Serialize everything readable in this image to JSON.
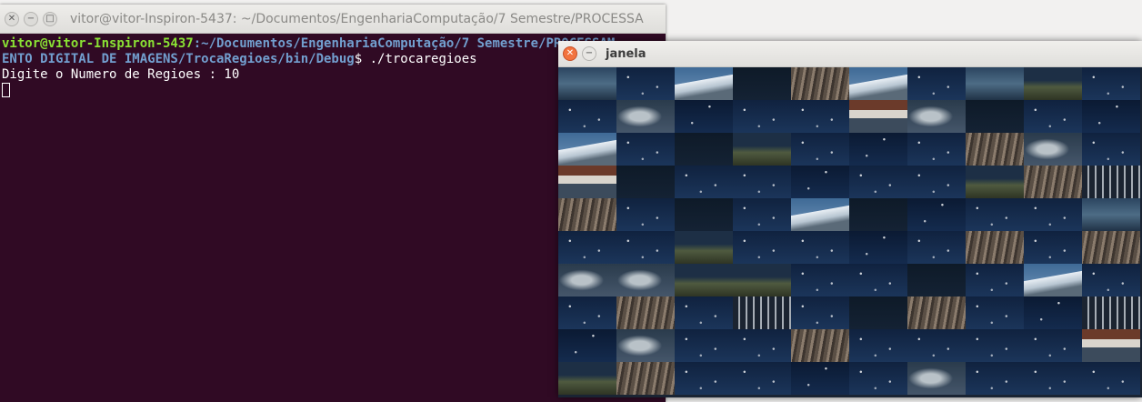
{
  "terminal": {
    "title": "vitor@vitor-Inspiron-5437: ~/Documentos/EngenhariaComputação/7 Semestre/PROCESSA",
    "prompt_user": "vitor@vitor-Inspiron-5437",
    "prompt_path_line1": "~/Documentos/EngenhariaComputação/7 Semestre/PROCESSAM",
    "prompt_path_line2": "ENTO DIGITAL DE IMAGENS/TrocaRegioes/bin/Debug",
    "prompt_symbol": "$ ",
    "command": "./trocaregioes",
    "output_line": "Digite o Numero de Regioes : 10"
  },
  "janela": {
    "title": "janela",
    "grid": {
      "rows": 10,
      "cols": 10
    }
  },
  "tiles": [
    "t-water",
    "t-star",
    "t-mtn",
    "t-dark",
    "t-dock",
    "t-mtn",
    "t-star",
    "t-water",
    "t-land",
    "t-star",
    "t-star",
    "t-cloud",
    "t-star2",
    "t-star",
    "t-star",
    "t-house",
    "t-cloud",
    "t-dark",
    "t-star",
    "t-star2",
    "t-mtn",
    "t-star",
    "t-dark",
    "t-land",
    "t-star",
    "t-star2",
    "t-star",
    "t-dock",
    "t-cloud",
    "t-star",
    "t-house",
    "t-dark",
    "t-star",
    "t-star",
    "t-star2",
    "t-star",
    "t-star",
    "t-land",
    "t-dock",
    "t-rail",
    "t-dock",
    "t-star",
    "t-dark",
    "t-star",
    "t-mtn",
    "t-dark",
    "t-star2",
    "t-star",
    "t-star",
    "t-water",
    "t-star",
    "t-star",
    "t-land",
    "t-star",
    "t-star",
    "t-star2",
    "t-star",
    "t-dock",
    "t-star",
    "t-dock",
    "t-cloud",
    "t-cloud",
    "t-land",
    "t-land",
    "t-star",
    "t-star",
    "t-dark",
    "t-star",
    "t-mtn",
    "t-star",
    "t-star",
    "t-dock",
    "t-star",
    "t-rail",
    "t-star",
    "t-dark",
    "t-dock",
    "t-star",
    "t-star2",
    "t-rail",
    "t-star2",
    "t-cloud",
    "t-star",
    "t-star",
    "t-dock",
    "t-star",
    "t-star",
    "t-star",
    "t-star",
    "t-house",
    "t-land",
    "t-dock",
    "t-star",
    "t-star",
    "t-star2",
    "t-star",
    "t-cloud",
    "t-star",
    "t-star",
    "t-star"
  ]
}
